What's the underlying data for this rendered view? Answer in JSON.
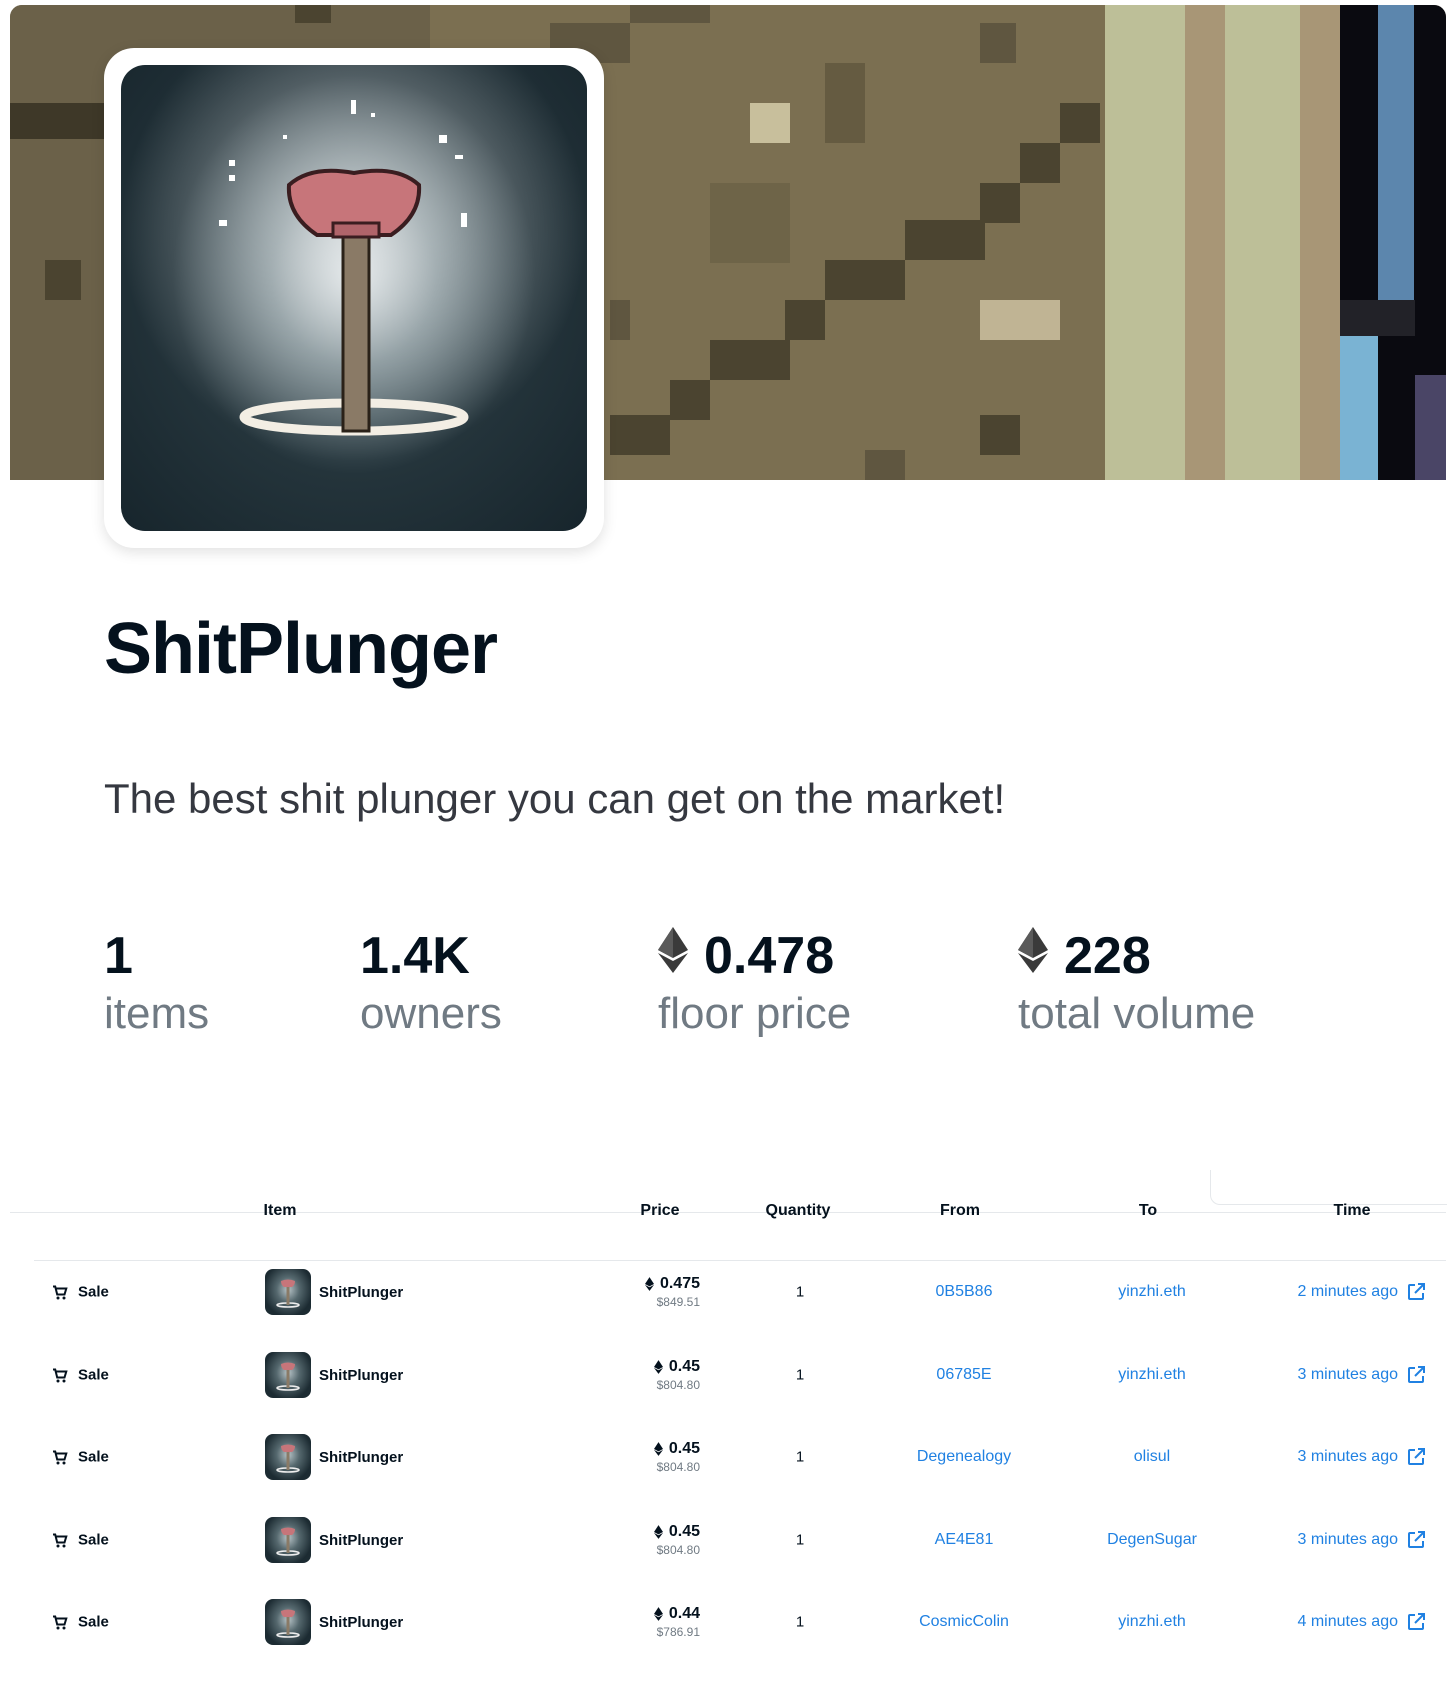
{
  "collection": {
    "name": "ShitPlunger",
    "description": "The best shit plunger you can get on the market!"
  },
  "stats": [
    {
      "value": "1",
      "label": "items",
      "eth": false
    },
    {
      "value": "1.4K",
      "label": "owners",
      "eth": false
    },
    {
      "value": "0.478",
      "label": "floor price",
      "eth": true
    },
    {
      "value": "228",
      "label": "total volume",
      "eth": true
    }
  ],
  "activity": {
    "columns": {
      "item": "Item",
      "price": "Price",
      "quantity": "Quantity",
      "from": "From",
      "to": "To",
      "time": "Time"
    },
    "rows": [
      {
        "event": "Sale",
        "item": "ShitPlunger",
        "price": "0.475",
        "usd": "$849.51",
        "quantity": "1",
        "from": "0B5B86",
        "to": "yinzhi.eth",
        "time": "2 minutes ago"
      },
      {
        "event": "Sale",
        "item": "ShitPlunger",
        "price": "0.45",
        "usd": "$804.80",
        "quantity": "1",
        "from": "06785E",
        "to": "yinzhi.eth",
        "time": "3 minutes ago"
      },
      {
        "event": "Sale",
        "item": "ShitPlunger",
        "price": "0.45",
        "usd": "$804.80",
        "quantity": "1",
        "from": "Degenealogy",
        "to": "olisul",
        "time": "3 minutes ago"
      },
      {
        "event": "Sale",
        "item": "ShitPlunger",
        "price": "0.45",
        "usd": "$804.80",
        "quantity": "1",
        "from": "AE4E81",
        "to": "DegenSugar",
        "time": "3 minutes ago"
      },
      {
        "event": "Sale",
        "item": "ShitPlunger",
        "price": "0.44",
        "usd": "$786.91",
        "quantity": "1",
        "from": "CosmicColin",
        "to": "yinzhi.eth",
        "time": "4 minutes ago"
      }
    ]
  },
  "icons": {
    "eth": "ethereum-icon",
    "sale": "cart-icon",
    "external": "external-link-icon"
  },
  "colors": {
    "link": "#2081e2",
    "text": "#04111d",
    "muted": "#707a83"
  }
}
